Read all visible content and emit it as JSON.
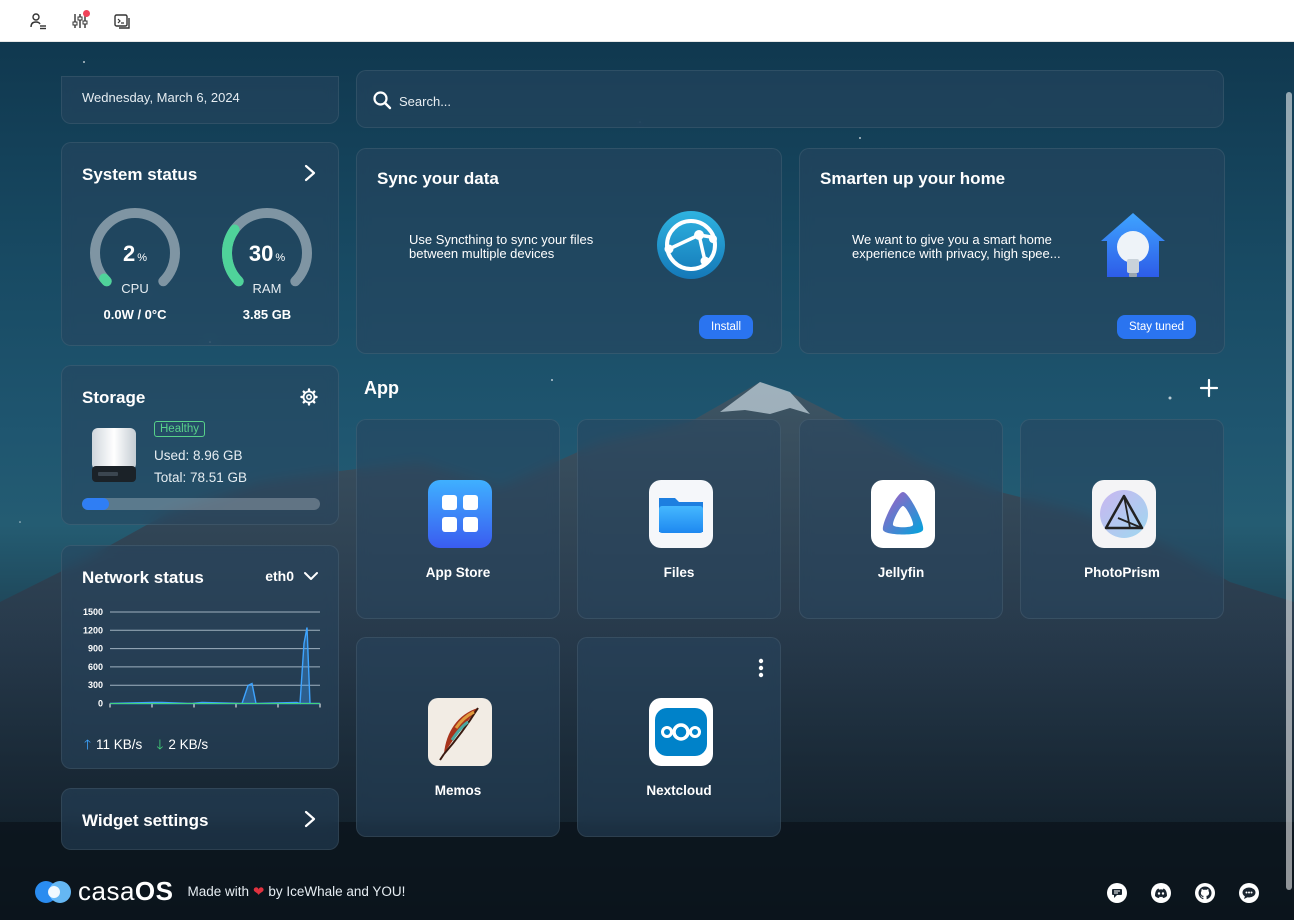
{
  "topbar": {
    "icons": [
      "user-settings-icon",
      "sliders-icon",
      "terminal-window-icon"
    ]
  },
  "date": "Wednesday, March 6, 2024",
  "search": {
    "placeholder": "Search..."
  },
  "system_status": {
    "title": "System status",
    "cpu": {
      "value": "2",
      "unit": "%",
      "label": "CPU",
      "footer": "0.0W / 0°C",
      "level": 0.02
    },
    "ram": {
      "value": "30",
      "unit": "%",
      "label": "RAM",
      "footer": "3.85 GB",
      "level": 0.3
    },
    "gauge_colors": {
      "track": "#7f95a3",
      "active": "#4fd39a"
    }
  },
  "storage": {
    "title": "Storage",
    "health": "Healthy",
    "used": "Used: 8.96 GB",
    "total": "Total: 78.51 GB",
    "used_fraction": 0.114
  },
  "network": {
    "title": "Network status",
    "interface": "eth0",
    "upload": "11 KB/s",
    "download": "2 KB/s",
    "y_ticks": [
      "1500",
      "1200",
      "900",
      "600",
      "300",
      "0"
    ]
  },
  "widget_settings": {
    "title": "Widget settings"
  },
  "features": [
    {
      "title": "Sync your data",
      "description": "Use Syncthing to sync your files between multiple devices",
      "button": "Install"
    },
    {
      "title": "Smarten up your home",
      "description": "We want to give you a smart home experience with privacy, high spee...",
      "button": "Stay tuned"
    }
  ],
  "apps_header": "App",
  "apps": [
    {
      "name": "App Store"
    },
    {
      "name": "Files"
    },
    {
      "name": "Jellyfin"
    },
    {
      "name": "PhotoPrism"
    },
    {
      "name": "Memos"
    },
    {
      "name": "Nextcloud"
    }
  ],
  "footer": {
    "logo_text_light": "casa",
    "logo_text_bold": "OS",
    "made_with": "Made with",
    "by": "by IceWhale and YOU!",
    "social_icons": [
      "chat-bubble-icon",
      "discord-icon",
      "github-icon",
      "message-icon"
    ]
  },
  "colors": {
    "accent": "#2a74f0",
    "healthy": "#58d18a",
    "upload": "#3ea4ff",
    "download": "#43d37a",
    "heart": "#e0323f"
  }
}
